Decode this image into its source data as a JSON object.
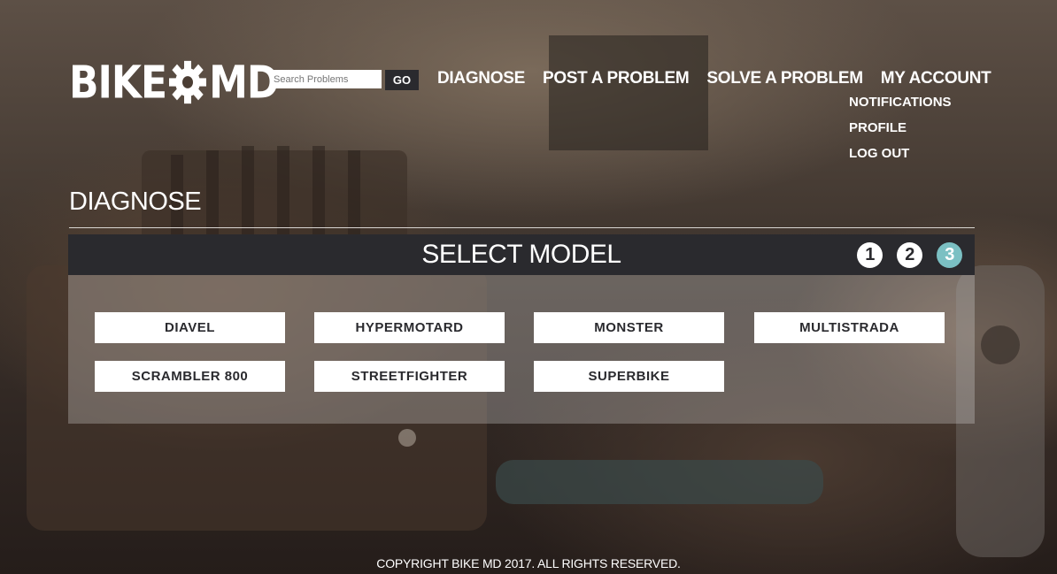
{
  "brand": {
    "logo_text_left": "BIKE",
    "logo_text_right": "MD"
  },
  "search": {
    "placeholder": "Search Problems",
    "button_label": "GO"
  },
  "nav": {
    "diagnose": "DIAGNOSE",
    "post": "POST A PROBLEM",
    "solve": "SOLVE A PROBLEM",
    "account": "MY ACCOUNT"
  },
  "account_menu": {
    "notifications": "NOTIFICATIONS",
    "profile": "PROFILE",
    "logout": "LOG OUT"
  },
  "page": {
    "title": "DIAGNOSE",
    "panel_title": "SELECT MODEL"
  },
  "steps": [
    "1",
    "2",
    "3"
  ],
  "active_step": 3,
  "models": [
    "DIAVEL",
    "HYPERMOTARD",
    "MONSTER",
    "MULTISTRADA",
    "SCRAMBLER 800",
    "STREETFIGHTER",
    "SUPERBIKE"
  ],
  "colors": {
    "dark": "#2a2a2e",
    "accent": "#7bc0c3"
  },
  "footer": {
    "text": "COPYRIGHT BIKE MD 2017. ALL RIGHTS RESERVED."
  }
}
